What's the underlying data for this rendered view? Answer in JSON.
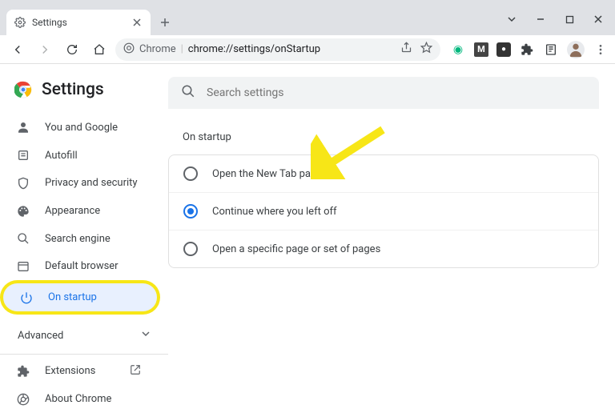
{
  "window": {
    "tab_title": "Settings",
    "address_host": "Chrome",
    "address_path": "chrome://settings/onStartup"
  },
  "page": {
    "title": "Settings",
    "search_placeholder": "Search settings"
  },
  "sidebar": {
    "items": [
      {
        "label": "You and Google"
      },
      {
        "label": "Autofill"
      },
      {
        "label": "Privacy and security"
      },
      {
        "label": "Appearance"
      },
      {
        "label": "Search engine"
      },
      {
        "label": "Default browser"
      },
      {
        "label": "On startup"
      }
    ],
    "advanced_label": "Advanced",
    "extensions_label": "Extensions",
    "about_label": "About Chrome"
  },
  "main": {
    "section_title": "On startup",
    "options": [
      {
        "label": "Open the New Tab page"
      },
      {
        "label": "Continue where you left off"
      },
      {
        "label": "Open a specific page or set of pages"
      }
    ],
    "selected_index": 1
  }
}
